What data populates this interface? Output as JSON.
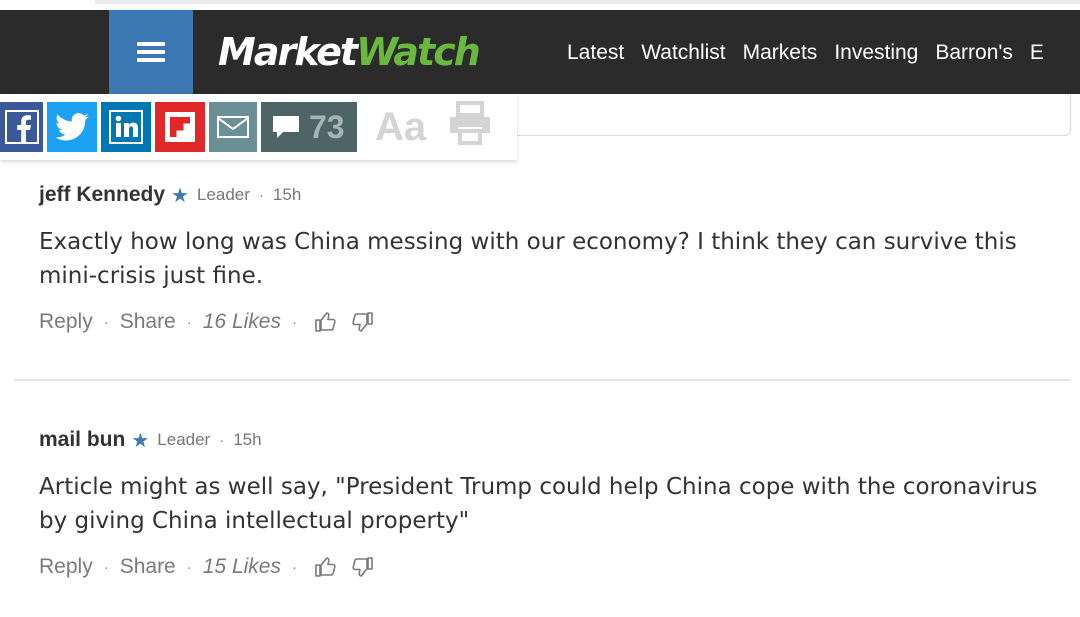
{
  "site": {
    "logo_market": "Market",
    "logo_watch": "Watch",
    "colors": {
      "header_bg": "#2b2b2b",
      "menu_bg": "#3b77b3",
      "logo_green": "#6ab83e",
      "accent_blue": "#3d7ab5"
    }
  },
  "nav": {
    "items": [
      {
        "label": "Latest"
      },
      {
        "label": "Watchlist"
      },
      {
        "label": "Markets"
      },
      {
        "label": "Investing"
      },
      {
        "label": "Barron's"
      },
      {
        "label": "E"
      }
    ]
  },
  "toolbar": {
    "icons": [
      "facebook-icon",
      "twitter-icon",
      "linkedin-icon",
      "flipboard-icon",
      "email-icon",
      "comment-icon",
      "font-size-icon",
      "print-icon"
    ],
    "comment_count": "73",
    "font_size_label": "Aa"
  },
  "comments": [
    {
      "author": "jeff Kennedy",
      "star": "★",
      "badge": "Leader",
      "dot": "·",
      "time": "15h",
      "text": "Exactly how long was China messing with our economy?  I think they can survive this mini-crisis just fine.",
      "reply_label": "Reply",
      "share_label": "Share",
      "likes": "16 Likes"
    },
    {
      "author": "mail bun",
      "star": "★",
      "badge": "Leader",
      "dot": "·",
      "time": "15h",
      "text": "Article might as well say, \"President Trump could help China cope with the coronavirus by giving China intellectual property\"",
      "reply_label": "Reply",
      "share_label": "Share",
      "likes": "15 Likes"
    }
  ]
}
